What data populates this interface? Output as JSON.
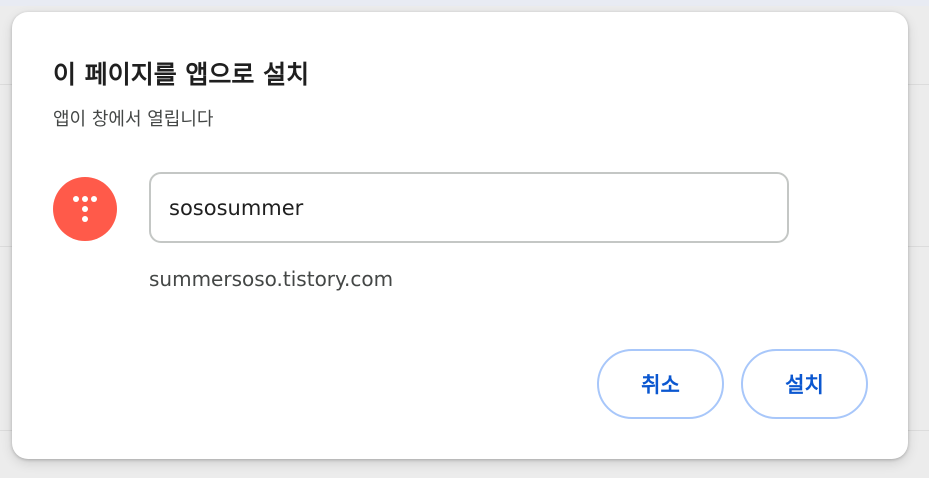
{
  "dialog": {
    "title": "이 페이지를 앱으로 설치",
    "subtitle": "앱이 창에서 열립니다",
    "app": {
      "icon": "tistory-logo-icon",
      "icon_color": "#ff5a4a",
      "name_value": "sososummer",
      "origin": "summersoso.tistory.com"
    },
    "buttons": {
      "cancel_label": "취소",
      "install_label": "설치"
    },
    "accent_color": "#0b57d0",
    "button_border_color": "#a8c7fa"
  }
}
